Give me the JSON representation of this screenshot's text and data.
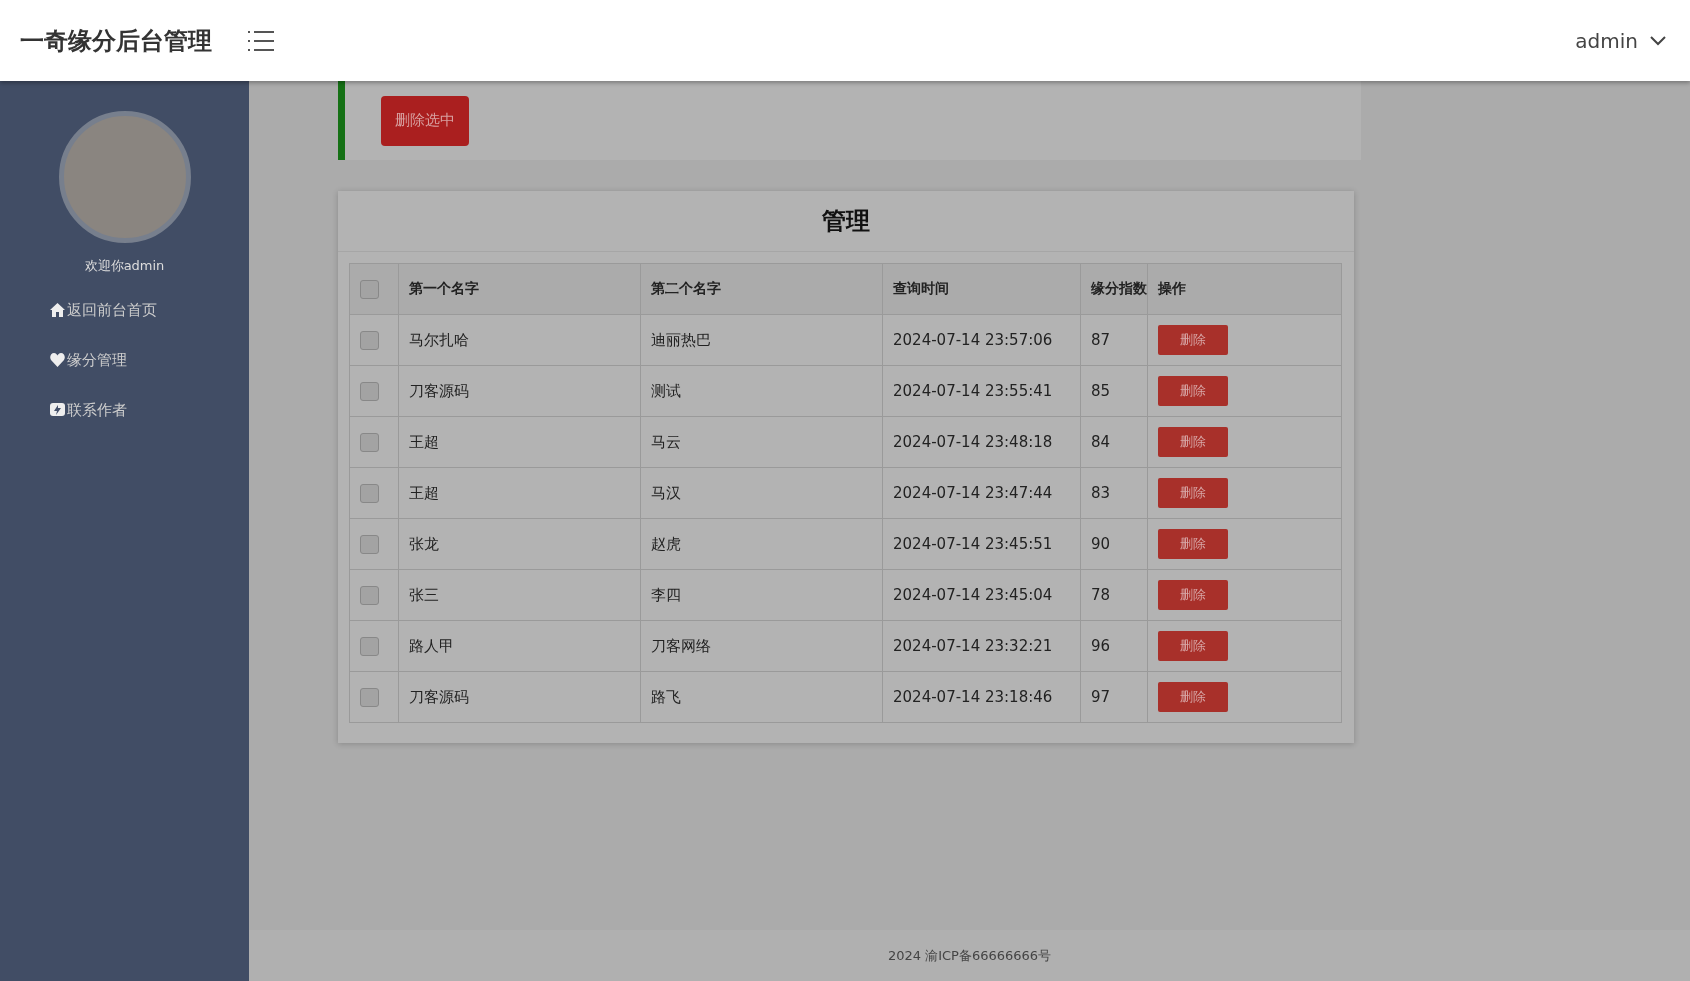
{
  "header": {
    "title": "一奇缘分后台管理",
    "user": "admin"
  },
  "sidebar": {
    "welcome": "欢迎你admin",
    "items": [
      {
        "kind": "home",
        "label": "返回前台首页"
      },
      {
        "kind": "heart",
        "label": "缘分管理"
      },
      {
        "kind": "contact",
        "label": "联系作者"
      }
    ]
  },
  "toolbar": {
    "delete_selected": "删除选中"
  },
  "panel": {
    "title": "管理",
    "columns": [
      "第一个名字",
      "第二个名字",
      "查询时间",
      "缘分指数",
      "操作"
    ],
    "select_all_checked": false,
    "rows": [
      {
        "checked": false,
        "first": "马尔扎哈",
        "second": "迪丽热巴",
        "time": "2024-07-14 23:57:06",
        "score": "87",
        "action": "删除"
      },
      {
        "checked": false,
        "first": "刀客源码",
        "second": "测试",
        "time": "2024-07-14 23:55:41",
        "score": "85",
        "action": "删除"
      },
      {
        "checked": false,
        "first": "王超",
        "second": "马云",
        "time": "2024-07-14 23:48:18",
        "score": "84",
        "action": "删除"
      },
      {
        "checked": false,
        "first": "王超",
        "second": "马汉",
        "time": "2024-07-14 23:47:44",
        "score": "83",
        "action": "删除"
      },
      {
        "checked": false,
        "first": "张龙",
        "second": "赵虎",
        "time": "2024-07-14 23:45:51",
        "score": "90",
        "action": "删除"
      },
      {
        "checked": false,
        "first": "张三",
        "second": "李四",
        "time": "2024-07-14 23:45:04",
        "score": "78",
        "action": "删除"
      },
      {
        "checked": false,
        "first": "路人甲",
        "second": "刀客网络",
        "time": "2024-07-14 23:32:21",
        "score": "96",
        "action": "删除"
      },
      {
        "checked": false,
        "first": "刀客源码",
        "second": "路飞",
        "time": "2024-07-14 23:18:46",
        "score": "97",
        "action": "删除"
      }
    ]
  },
  "footer": "2024 渝ICP备66666666号"
}
